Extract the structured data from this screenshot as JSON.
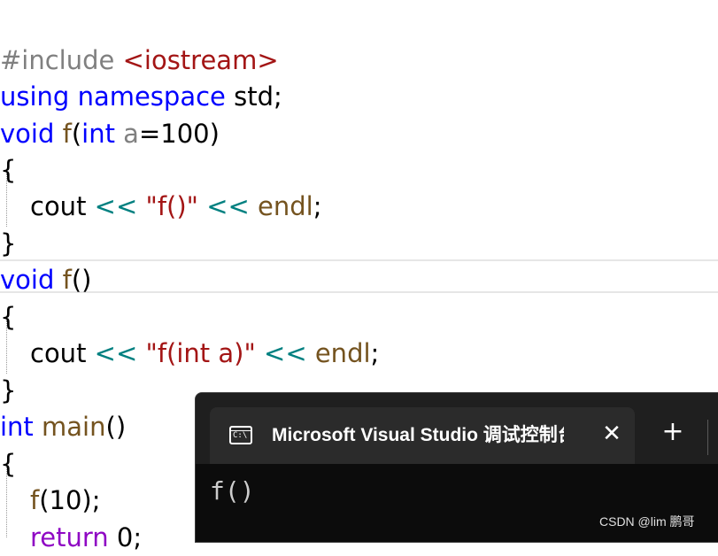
{
  "code": {
    "line1": {
      "directive": "#include",
      "header": "<iostream>"
    },
    "line2": {
      "kw1": "using",
      "kw2": "namespace",
      "rest": "std;"
    },
    "line3": {
      "kw": "void",
      "fn": "f",
      "open": "(",
      "kwType": "int",
      "param": "a",
      "rest": "=100)"
    },
    "line4": "{",
    "line5": {
      "ident": "cout",
      "op1": "<<",
      "str": "\"f()\"",
      "op2": "<<",
      "endl": "endl",
      "semi": ";"
    },
    "line6": "}",
    "line7": {
      "kw": "void",
      "fn": "f",
      "rest": "()"
    },
    "line8": "{",
    "line9": {
      "ident": "cout",
      "op1": "<<",
      "str": "\"f(int a)\"",
      "op2": "<<",
      "endl": "endl",
      "semi": ";"
    },
    "line10": "}",
    "line11": {
      "kw": "int",
      "fn": "main",
      "rest": "()"
    },
    "line12": "{",
    "line13": {
      "fn": "f",
      "rest": "(10);"
    },
    "line14": {
      "kw": "return",
      "rest": " 0;"
    }
  },
  "console": {
    "tab_title": "Microsoft Visual Studio 调试控制台",
    "icon_text": "C:\\",
    "close_glyph": "✕",
    "new_tab_glyph": "+",
    "output": "f()"
  },
  "watermark": "CSDN @lim 鹏哥",
  "colors": {
    "keyword": "#0000ff",
    "function": "#74531f",
    "string": "#a31515",
    "operator": "#008080",
    "console_bg": "#0c0c0c"
  }
}
